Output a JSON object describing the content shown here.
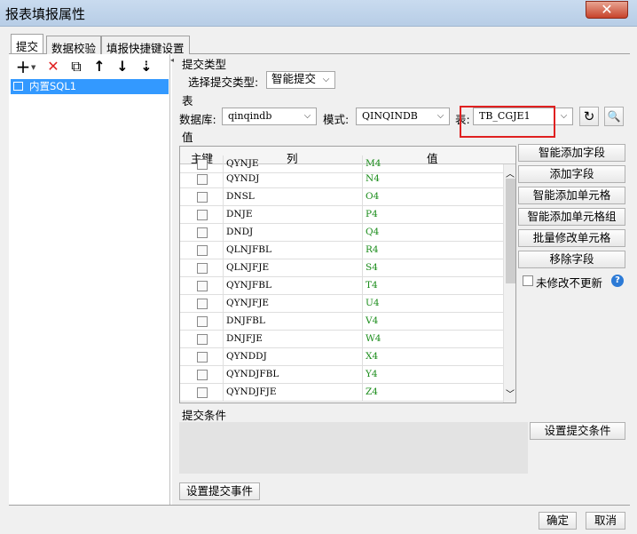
{
  "window": {
    "title": "报表填报属性",
    "close_glyph": "✕"
  },
  "tabs": [
    {
      "label": "提交"
    },
    {
      "label": "数据校验"
    },
    {
      "label": "填报快捷键设置"
    }
  ],
  "toolbar": {
    "add": "+",
    "delete": "✕",
    "copy": "⧉",
    "up": "↑",
    "down": "↓",
    "sort": "⇣"
  },
  "tree": {
    "items": [
      {
        "label": "内置SQL1"
      }
    ]
  },
  "submit_type": {
    "section_label": "提交类型",
    "select_label": "选择提交类型:",
    "value": "智能提交"
  },
  "table_section": {
    "section_label": "表",
    "db_label": "数据库:",
    "db_value": "qinqindb",
    "schema_label": "模式:",
    "schema_value": "QINQINDB",
    "table_label": "表:",
    "table_value": "TB_CGJE1"
  },
  "values_section": {
    "section_label": "值",
    "headers": {
      "key": "主键",
      "column": "列",
      "value": "值"
    },
    "partial_row": {
      "column": "QYNJE",
      "value": "M4"
    },
    "rows": [
      {
        "column": "QYNDJ",
        "value": "N4"
      },
      {
        "column": "DNSL",
        "value": "O4"
      },
      {
        "column": "DNJE",
        "value": "P4"
      },
      {
        "column": "DNDJ",
        "value": "Q4"
      },
      {
        "column": "QLNJFBL",
        "value": "R4"
      },
      {
        "column": "QLNJFJE",
        "value": "S4"
      },
      {
        "column": "QYNJFBL",
        "value": "T4"
      },
      {
        "column": "QYNJFJE",
        "value": "U4"
      },
      {
        "column": "DNJFBL",
        "value": "V4"
      },
      {
        "column": "DNJFJE",
        "value": "W4"
      },
      {
        "column": "QYNDDJ",
        "value": "X4"
      },
      {
        "column": "QYNDJFBL",
        "value": "Y4"
      },
      {
        "column": "QYNDJFJE",
        "value": "Z4"
      }
    ]
  },
  "side_buttons": {
    "smart_add_field": "智能添加字段",
    "add_field": "添加字段",
    "smart_add_cell": "智能添加单元格",
    "smart_add_cell_group": "智能添加单元格组",
    "batch_modify_cell": "批量修改单元格",
    "remove_field": "移除字段",
    "no_update_unmodified": "未修改不更新",
    "help_glyph": "?"
  },
  "condition": {
    "section_label": "提交条件",
    "set_condition_button": "设置提交条件"
  },
  "event_button": "设置提交事件",
  "footer": {
    "ok": "确定",
    "cancel": "取消"
  }
}
